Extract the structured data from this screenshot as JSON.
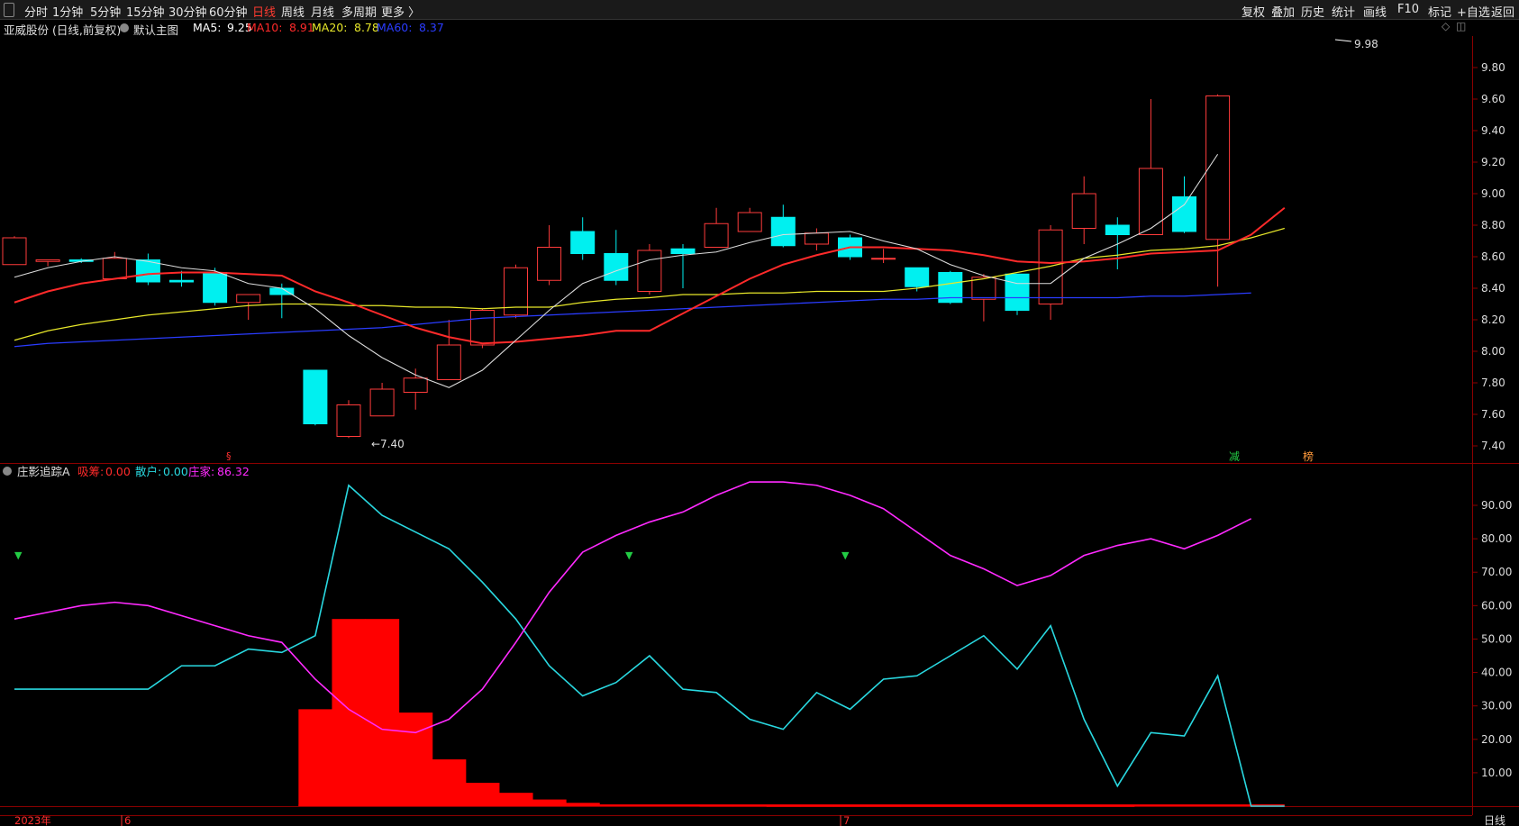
{
  "topbar": {
    "left_tabs": [
      "分时",
      "1分钟",
      "5分钟",
      "15分钟",
      "30分钟",
      "60分钟",
      "日线",
      "周线",
      "月线",
      "多周期",
      "更多 〉"
    ],
    "active_tab": "日线",
    "right_tabs": [
      "复权",
      "叠加",
      "历史",
      "统计",
      "画线",
      "F10",
      "标记",
      "+自选",
      "返回"
    ]
  },
  "main_chart": {
    "stock_title": "亚威股份 (日线,前复权)",
    "main_label": "默认主图",
    "ma": [
      {
        "label": "MA5:",
        "value": "9.25",
        "color": "#ffffff"
      },
      {
        "label": "MA10:",
        "value": "8.91",
        "color": "#ff2a2a"
      },
      {
        "label": "MA20:",
        "value": "8.78",
        "color": "#e8e82a"
      },
      {
        "label": "MA60:",
        "value": "8.37",
        "color": "#2a3cff"
      }
    ],
    "high_marker": "9.98",
    "low_marker": "←7.40",
    "y_ticks": [
      "9.80",
      "9.60",
      "9.40",
      "9.20",
      "9.00",
      "8.80",
      "8.60",
      "8.40",
      "8.20",
      "8.00",
      "7.80",
      "7.60",
      "7.40"
    ],
    "tags": [
      {
        "text": "减",
        "color": "#22cc44"
      },
      {
        "text": "榜",
        "color": "#ff9a3c"
      },
      {
        "text": "§",
        "color": "#ff3030"
      }
    ]
  },
  "sub_chart": {
    "title": "庄影追踪A",
    "legend": [
      {
        "label": "吸筹:",
        "value": "0.00",
        "color": "#ff2a2a"
      },
      {
        "label": "散户:",
        "value": "0.00",
        "color": "#29d8e0"
      },
      {
        "label": "庄家:",
        "value": "86.32",
        "color": "#ff2aff"
      }
    ],
    "y_ticks": [
      "90.00",
      "80.00",
      "70.00",
      "60.00",
      "50.00",
      "40.00",
      "30.00",
      "20.00",
      "10.00"
    ]
  },
  "bottom_axis": {
    "year_label": "2023年",
    "month_labels": [
      "6",
      "7"
    ],
    "period_label": "日线"
  },
  "chart_data": [
    {
      "type": "candlestick",
      "y_range": [
        7.3,
        10.05
      ],
      "candles": [
        {
          "o": 8.55,
          "h": 8.73,
          "l": 8.55,
          "c": 8.72
        },
        {
          "o": 8.57,
          "h": 8.58,
          "l": 8.54,
          "c": 8.58
        },
        {
          "o": 8.58,
          "h": 8.59,
          "l": 8.56,
          "c": 8.57
        },
        {
          "o": 8.46,
          "h": 8.63,
          "l": 8.46,
          "c": 8.59
        },
        {
          "o": 8.58,
          "h": 8.62,
          "l": 8.42,
          "c": 8.44
        },
        {
          "o": 8.45,
          "h": 8.51,
          "l": 8.41,
          "c": 8.44
        },
        {
          "o": 8.5,
          "h": 8.53,
          "l": 8.29,
          "c": 8.31
        },
        {
          "o": 8.31,
          "h": 8.36,
          "l": 8.2,
          "c": 8.36
        },
        {
          "o": 8.4,
          "h": 8.43,
          "l": 8.21,
          "c": 8.36
        },
        {
          "o": 7.88,
          "h": 7.88,
          "l": 7.53,
          "c": 7.54
        },
        {
          "o": 7.46,
          "h": 7.69,
          "l": 7.45,
          "c": 7.66
        },
        {
          "o": 7.59,
          "h": 7.8,
          "l": 7.59,
          "c": 7.76
        },
        {
          "o": 7.74,
          "h": 7.89,
          "l": 7.63,
          "c": 7.83
        },
        {
          "o": 7.82,
          "h": 8.2,
          "l": 7.82,
          "c": 8.04
        },
        {
          "o": 8.04,
          "h": 8.27,
          "l": 8.02,
          "c": 8.26
        },
        {
          "o": 8.23,
          "h": 8.55,
          "l": 8.21,
          "c": 8.53
        },
        {
          "o": 8.45,
          "h": 8.8,
          "l": 8.42,
          "c": 8.66
        },
        {
          "o": 8.76,
          "h": 8.85,
          "l": 8.58,
          "c": 8.62
        },
        {
          "o": 8.62,
          "h": 8.77,
          "l": 8.42,
          "c": 8.45
        },
        {
          "o": 8.38,
          "h": 8.68,
          "l": 8.36,
          "c": 8.64
        },
        {
          "o": 8.65,
          "h": 8.68,
          "l": 8.4,
          "c": 8.62
        },
        {
          "o": 8.66,
          "h": 8.91,
          "l": 8.66,
          "c": 8.81
        },
        {
          "o": 8.76,
          "h": 8.91,
          "l": 8.76,
          "c": 8.88
        },
        {
          "o": 8.85,
          "h": 8.93,
          "l": 8.66,
          "c": 8.67
        },
        {
          "o": 8.68,
          "h": 8.78,
          "l": 8.64,
          "c": 8.75
        },
        {
          "o": 8.72,
          "h": 8.74,
          "l": 8.58,
          "c": 8.6
        },
        {
          "o": 8.59,
          "h": 8.65,
          "l": 8.56,
          "c": 8.59
        },
        {
          "o": 8.53,
          "h": 8.53,
          "l": 8.38,
          "c": 8.41
        },
        {
          "o": 8.5,
          "h": 8.51,
          "l": 8.3,
          "c": 8.31
        },
        {
          "o": 8.33,
          "h": 8.49,
          "l": 8.19,
          "c": 8.47
        },
        {
          "o": 8.49,
          "h": 8.49,
          "l": 8.23,
          "c": 8.26
        },
        {
          "o": 8.3,
          "h": 8.8,
          "l": 8.2,
          "c": 8.77
        },
        {
          "o": 8.78,
          "h": 9.11,
          "l": 8.68,
          "c": 9.0
        },
        {
          "o": 8.8,
          "h": 8.85,
          "l": 8.52,
          "c": 8.74
        },
        {
          "o": 8.74,
          "h": 9.6,
          "l": 8.74,
          "c": 9.16
        },
        {
          "o": 8.98,
          "h": 9.11,
          "l": 8.75,
          "c": 8.76
        },
        {
          "o": 8.71,
          "h": 9.63,
          "l": 8.41,
          "c": 9.62
        }
      ],
      "ma5": [
        8.47,
        8.53,
        8.57,
        8.6,
        8.57,
        8.53,
        8.51,
        8.43,
        8.4,
        8.27,
        8.1,
        7.96,
        7.85,
        7.77,
        7.88,
        8.07,
        8.26,
        8.43,
        8.51,
        8.58,
        8.61,
        8.63,
        8.69,
        8.74,
        8.75,
        8.76,
        8.7,
        8.65,
        8.55,
        8.48,
        8.43,
        8.43,
        8.59,
        8.68,
        8.78,
        8.93,
        9.25
      ],
      "ma10": [
        8.31,
        8.38,
        8.43,
        8.46,
        8.49,
        8.5,
        8.5,
        8.49,
        8.48,
        8.38,
        8.31,
        8.23,
        8.15,
        8.09,
        8.05,
        8.06,
        8.08,
        8.1,
        8.13,
        8.13,
        8.24,
        8.35,
        8.46,
        8.55,
        8.61,
        8.66,
        8.66,
        8.65,
        8.64,
        8.61,
        8.57,
        8.56,
        8.57,
        8.59,
        8.62,
        8.63,
        8.64,
        8.74,
        8.91
      ],
      "ma20": [
        8.07,
        8.13,
        8.17,
        8.2,
        8.23,
        8.25,
        8.27,
        8.29,
        8.3,
        8.3,
        8.29,
        8.29,
        8.28,
        8.28,
        8.27,
        8.28,
        8.28,
        8.31,
        8.33,
        8.34,
        8.36,
        8.36,
        8.37,
        8.37,
        8.38,
        8.38,
        8.38,
        8.4,
        8.43,
        8.46,
        8.5,
        8.54,
        8.59,
        8.61,
        8.64,
        8.65,
        8.67,
        8.72,
        8.78
      ],
      "ma60": [
        8.03,
        8.05,
        8.06,
        8.07,
        8.08,
        8.09,
        8.1,
        8.11,
        8.12,
        8.13,
        8.14,
        8.15,
        8.17,
        8.19,
        8.21,
        8.22,
        8.23,
        8.24,
        8.25,
        8.26,
        8.27,
        8.28,
        8.29,
        8.3,
        8.31,
        8.32,
        8.33,
        8.33,
        8.34,
        8.34,
        8.34,
        8.34,
        8.34,
        8.34,
        8.35,
        8.35,
        8.36,
        8.37
      ]
    },
    {
      "type": "line",
      "y_range": [
        0,
        100
      ],
      "series": [
        {
          "name": "散户",
          "values": [
            35,
            35,
            35,
            35,
            35,
            42,
            42,
            47,
            46,
            51,
            96,
            87,
            82,
            77,
            67,
            56,
            42,
            33,
            37,
            45,
            35,
            34,
            26,
            23,
            34,
            29,
            38,
            39,
            45,
            51,
            41,
            54,
            26,
            6,
            22,
            21,
            39,
            0,
            0
          ]
        },
        {
          "name": "庄家",
          "values": [
            56,
            58,
            60,
            61,
            60,
            57,
            54,
            51,
            49,
            38,
            29,
            23,
            22,
            26,
            35,
            49,
            64,
            76,
            81,
            85,
            88,
            93,
            97,
            97,
            96,
            93,
            89,
            82,
            75,
            71,
            66,
            69,
            75,
            78,
            80,
            77,
            81,
            86
          ]
        },
        {
          "name": "吸筹",
          "values": [
            0,
            0,
            0,
            0,
            0,
            0,
            0,
            0,
            0,
            29,
            56,
            56,
            28,
            14,
            7,
            4,
            2,
            1,
            0.5,
            0.3,
            0.3,
            0.2,
            0.2,
            0.1,
            0.1,
            0.1,
            0.1,
            0.1,
            0.1,
            0.1,
            0.1,
            0.1,
            0.1,
            0.1,
            0,
            0,
            0,
            0,
            0
          ]
        }
      ]
    }
  ]
}
